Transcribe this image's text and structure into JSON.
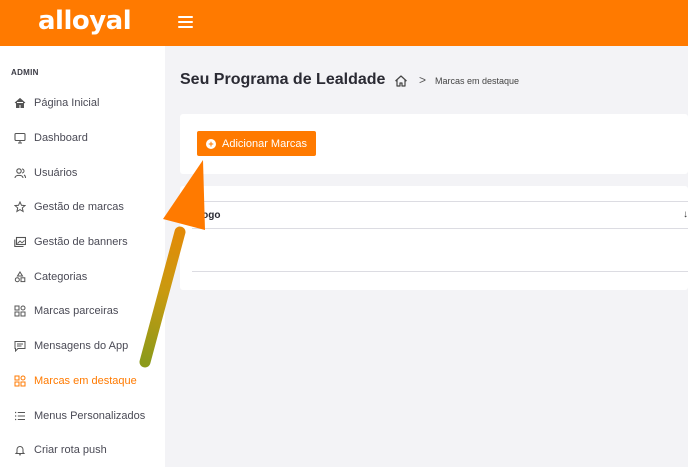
{
  "header": {
    "logo_text": "alloyal",
    "menu_icon": "hamburger-icon",
    "accent_color": "#ff7a00"
  },
  "sidebar": {
    "section_label": "ADMIN",
    "items": [
      {
        "label": "Página Inicial",
        "icon": "home-icon"
      },
      {
        "label": "Dashboard",
        "icon": "monitor-icon"
      },
      {
        "label": "Usuários",
        "icon": "users-icon"
      },
      {
        "label": "Gestão de marcas",
        "icon": "star-icon"
      },
      {
        "label": "Gestão de banners",
        "icon": "images-icon"
      },
      {
        "label": "Categorias",
        "icon": "shapes-icon"
      },
      {
        "label": "Marcas parceiras",
        "icon": "grid-icon"
      },
      {
        "label": "Mensagens do App",
        "icon": "message-icon"
      },
      {
        "label": "Marcas em destaque",
        "icon": "grid-icon",
        "active": true
      },
      {
        "label": "Menus Personalizados",
        "icon": "list-icon"
      },
      {
        "label": "Criar rota push",
        "icon": "bell-icon"
      }
    ]
  },
  "main": {
    "title": "Seu Programa de Lealdade",
    "breadcrumb": {
      "home_icon": "home-icon",
      "separator": ">",
      "current": "Marcas em destaque"
    },
    "add_button_label": "Adicionar Marcas",
    "table": {
      "columns": [
        "Logo"
      ]
    }
  },
  "annotation": {
    "arrow_color": "#ff7a00"
  }
}
